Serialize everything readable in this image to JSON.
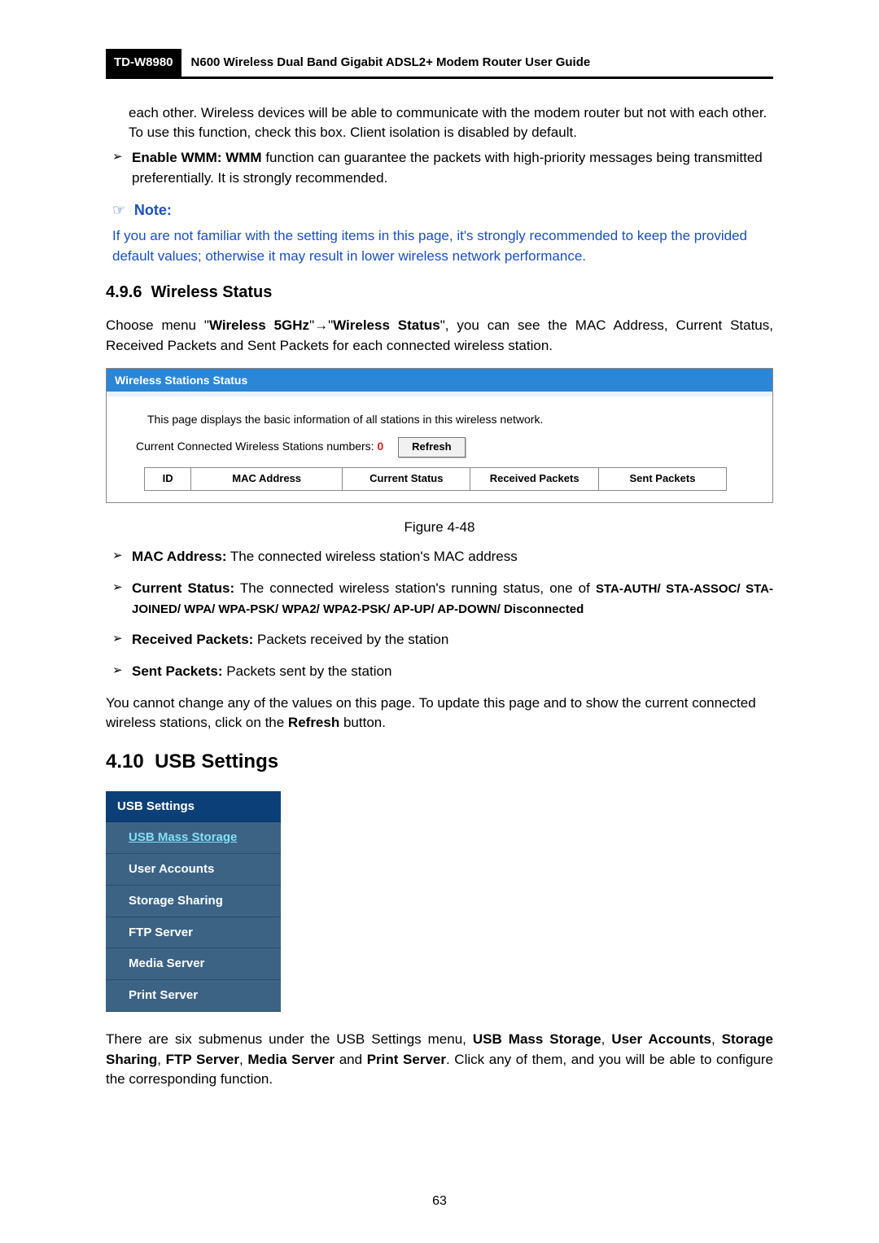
{
  "header": {
    "model": "TD-W8980",
    "guide_title": "N600 Wireless Dual Band Gigabit ADSL2+ Modem Router User Guide"
  },
  "intro1": "each other. Wireless devices will be able to communicate with the modem router but not with each other. To use this function, check this box. Client isolation is disabled by default.",
  "bullet_wmm_label": "Enable WMM: WMM",
  "bullet_wmm_rest": " function can guarantee the packets with high-priority messages being transmitted preferentially. It is strongly recommended.",
  "note": {
    "icon": "☞",
    "label": "Note:",
    "body": "If you are not familiar with the setting items in this page, it's strongly recommended to keep the provided default values; otherwise it may result in lower wireless network performance."
  },
  "subsection_num": "4.9.6",
  "subsection_title": "Wireless Status",
  "choose_pre": "Choose menu \"",
  "choose_b1": "Wireless 5GHz",
  "choose_arrow": "\"→\"",
  "choose_b2": "Wireless Status",
  "choose_post": "\", you can see the MAC Address, Current Status, Received Packets and Sent Packets for each connected wireless station.",
  "status_panel": {
    "title": "Wireless Stations Status",
    "line1": "This page displays the basic information of all stations in this wireless network.",
    "line2_pre": "Current Connected Wireless Stations numbers: ",
    "line2_num": "0",
    "refresh": "Refresh",
    "cols": {
      "c1": "ID",
      "c2": "MAC Address",
      "c3": "Current Status",
      "c4": "Received Packets",
      "c5": "Sent Packets"
    }
  },
  "figure_caption": "Figure 4-48",
  "bullets2": {
    "b1_label": "MAC Address:",
    "b1_text": " The connected wireless station's MAC address",
    "b2_label": "Current Status:",
    "b2_text": " The connected wireless station's running status, one of ",
    "b2_tail": "STA-AUTH/ STA-ASSOC/ STA-JOINED/ WPA/ WPA-PSK/ WPA2/ WPA2-PSK/ AP-UP/ AP-DOWN/ Disconnected",
    "b3_label": "Received Packets:",
    "b3_text": " Packets received by the station",
    "b4_label": "Sent Packets:",
    "b4_text": " Packets sent by the station"
  },
  "refresh_para_pre": "You cannot change any of the values on this page. To update this page and to show the current connected wireless stations, click on the ",
  "refresh_para_b": "Refresh",
  "refresh_para_post": " button.",
  "section_num": "4.10",
  "section_title": "USB Settings",
  "usb_menu": {
    "header": "USB Settings",
    "items": [
      {
        "label": "USB Mass Storage",
        "active": true
      },
      {
        "label": "User Accounts",
        "active": false
      },
      {
        "label": "Storage Sharing",
        "active": false
      },
      {
        "label": "FTP Server",
        "active": false
      },
      {
        "label": "Media Server",
        "active": false
      },
      {
        "label": "Print Server",
        "active": false
      }
    ]
  },
  "submenus_pre": "There are six submenus under the USB Settings menu, ",
  "submenus_b1": "USB Mass Storage",
  "submenus_s1": ", ",
  "submenus_b2": "User Accounts",
  "submenus_s2": ", ",
  "submenus_b3": "Storage Sharing",
  "submenus_s3": ", ",
  "submenus_b4": "FTP Server",
  "submenus_s4": ", ",
  "submenus_b5": "Media Server",
  "submenus_s5": " and ",
  "submenus_b6": "Print Server",
  "submenus_post": ". Click any of them, and you will be able to configure the corresponding function.",
  "page_number": "63"
}
